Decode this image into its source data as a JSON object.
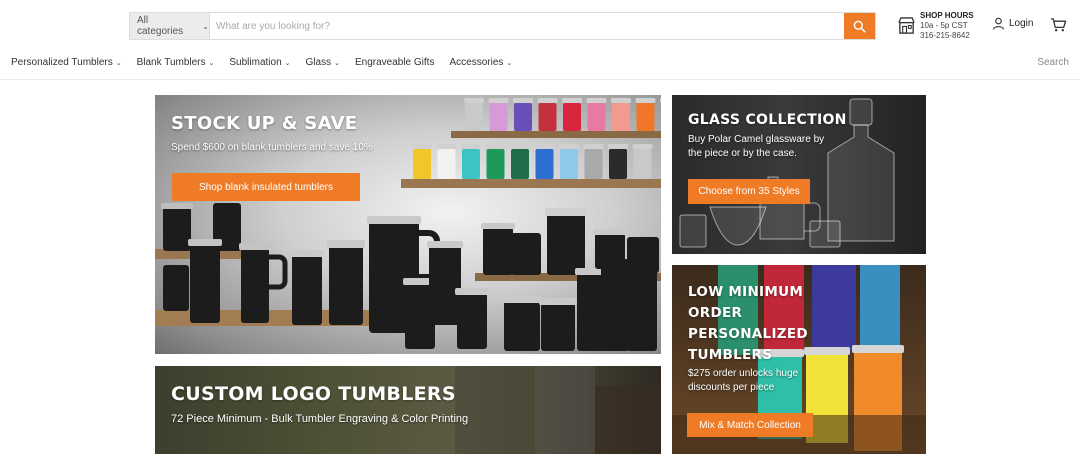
{
  "header": {
    "category_label": "All categories",
    "search_placeholder": "What are you looking for?",
    "shop_hours_title": "SHOP HOURS",
    "shop_hours_time": "10a - 5p CST",
    "shop_hours_phone": "316-215-8642",
    "login_label": "Login"
  },
  "nav": {
    "items": [
      {
        "label": "Personalized Tumblers",
        "dropdown": true
      },
      {
        "label": "Blank Tumblers",
        "dropdown": true
      },
      {
        "label": "Sublimation",
        "dropdown": true
      },
      {
        "label": "Glass",
        "dropdown": true
      },
      {
        "label": "Engraveable Gifts",
        "dropdown": false
      },
      {
        "label": "Accessories",
        "dropdown": true
      }
    ],
    "search_label": "Search"
  },
  "banners": {
    "stock": {
      "title": "STOCK UP & SAVE",
      "subtitle": "Spend $600 on blank tumblers and save 10%",
      "button": "Shop blank insulated tumblers"
    },
    "glass": {
      "title": "GLASS COLLECTION",
      "subtitle": "Buy Polar Camel glassware by the piece or by the case.",
      "button": "Choose from 35 Styles"
    },
    "low": {
      "title_lines": [
        "LOW MINIMUM",
        "ORDER",
        "PERSONALIZED",
        "TUMBLERS"
      ],
      "subtitle": "$275 order unlocks huge discounts per piece",
      "button": "Mix & Match Collection"
    },
    "custom": {
      "title": "CUSTOM LOGO TUMBLERS",
      "subtitle": "72 Piece Minimum - Bulk Tumbler Engraving & Color Printing"
    }
  },
  "colors": {
    "accent": "#f07b26",
    "tumbler_colors": [
      "#c9c9c9",
      "#d79ad9",
      "#6a4fb8",
      "#c4303c",
      "#d7263d",
      "#e879a4",
      "#f19a8d",
      "#f0762a",
      "#f2c62a",
      "#f2f2f2",
      "#3dc3c6",
      "#1d9a5b",
      "#1f6d4a",
      "#2c6fd0",
      "#8fc8e8",
      "#a9a9a9",
      "#2b2b2b"
    ]
  }
}
